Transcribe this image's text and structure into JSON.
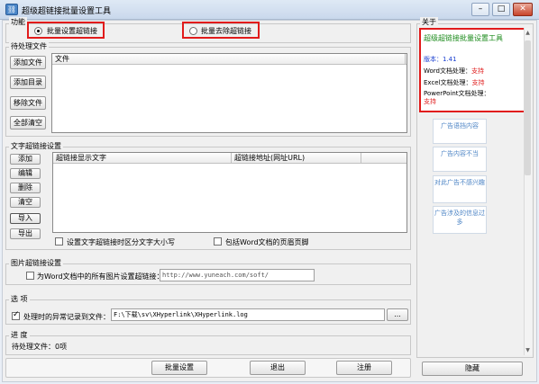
{
  "window": {
    "title": "超级超链接批量设置工具",
    "app_icon": "link-icon",
    "min_glyph": "–",
    "max_glyph": "□",
    "close_glyph": "✕"
  },
  "function": {
    "label": "功能",
    "option_set": "批量设置超链接",
    "option_remove": "批量去除超链接",
    "selected": "set"
  },
  "pending": {
    "label": "待处理文件",
    "column": "文件",
    "buttons": [
      "添加文件",
      "添加目录",
      "移除文件",
      "全部清空"
    ]
  },
  "text_link": {
    "label": "文字超链接设置",
    "columns": [
      "超链接显示文字",
      "超链接地址(网址URL)"
    ],
    "buttons": [
      "添加",
      "编辑",
      "删除",
      "清空",
      "导入",
      "导出"
    ],
    "case_checkbox": "设置文字超链接时区分文字大小写",
    "header_footer_checkbox": "包括Word文档的页眉页脚"
  },
  "image_link": {
    "label": "图片超链接设置",
    "checkbox": "为Word文档中的所有图片设置超链接：",
    "url": "http://www.yuneach.com/soft/"
  },
  "options": {
    "label": "选  项",
    "checkbox": "处理时的异常记录到文件：",
    "checked": true,
    "path": "F:\\下载\\sv\\XHyperlink\\XHyperlink.log",
    "browse": "..."
  },
  "progress": {
    "label": "进  度",
    "status": "待处理文件：0项"
  },
  "bottom": {
    "set_button": "批量设置",
    "exit_button": "退出",
    "register_button": "注册",
    "hide_button": "隐藏"
  },
  "about": {
    "label": "关于",
    "product": "超级超链接批量设置工具",
    "version_label": "版本：",
    "version": "1.41",
    "word_label": "Word文档处理：",
    "word_value": "支持",
    "excel_label": "Excel文档处理：",
    "excel_value": "支持",
    "ppt_label": "PowerPoint文档处理：",
    "ppt_value": "支持"
  },
  "ads": [
    "广告语挡内容",
    "广告内容不当",
    "对此广告不感兴趣",
    "广告涉及的信息过多"
  ],
  "colors": {
    "highlight": "#e11b1b",
    "green": "#1a8a1a",
    "version_blue": "#1a3fd0",
    "support_red": "#e02020",
    "ad_blue": "#4f86c6"
  }
}
